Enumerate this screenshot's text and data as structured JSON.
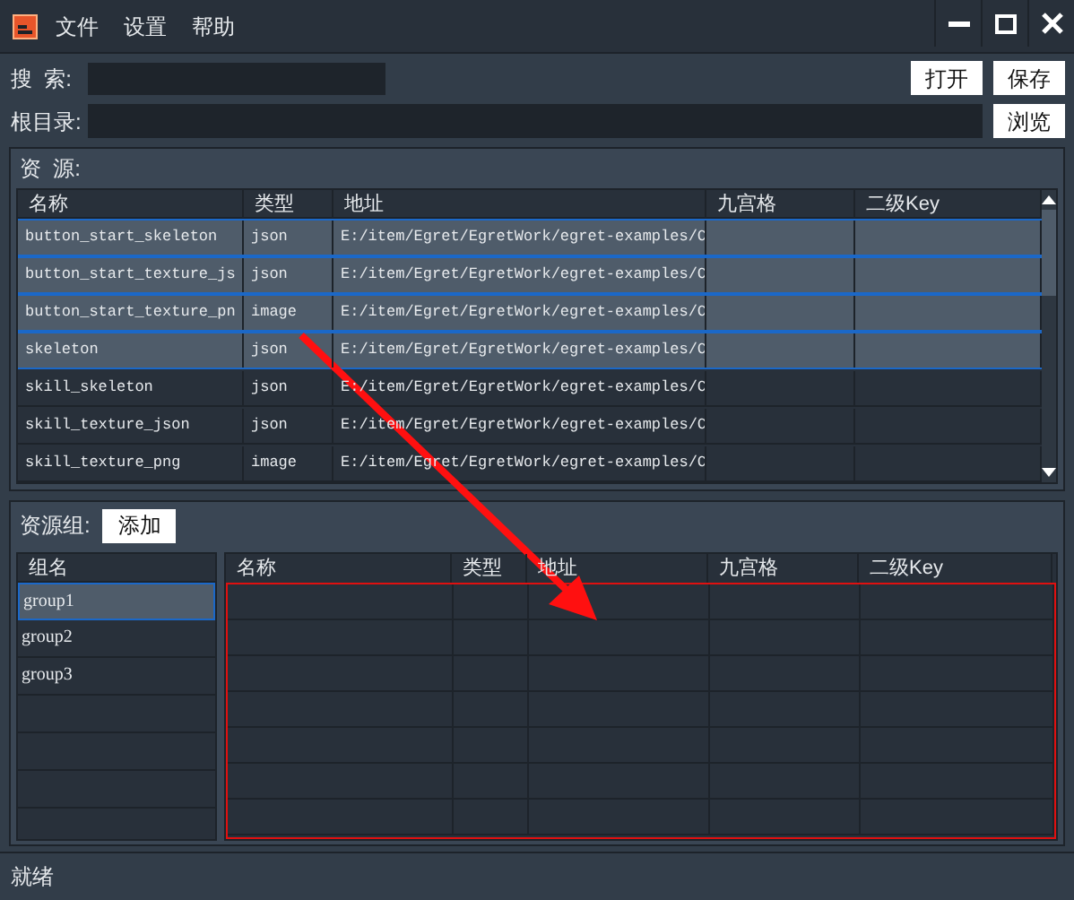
{
  "menu": [
    "文件",
    "设置",
    "帮助"
  ],
  "search": {
    "label": "搜  索:"
  },
  "root": {
    "label": "根目录:"
  },
  "buttons": [
    "打开",
    "保存"
  ],
  "browse_button": "浏览",
  "resources": {
    "title": "资  源:",
    "columns": [
      "名称",
      "类型",
      "地址",
      "九宫格",
      "二级Key"
    ],
    "rows": [
      {
        "name": "button_start_skeleton",
        "type": "json",
        "path": "E:/item/Egret/EgretWork/egret-examples/C",
        "selected": true
      },
      {
        "name": "button_start_texture_js",
        "type": "json",
        "path": "E:/item/Egret/EgretWork/egret-examples/C",
        "selected": true
      },
      {
        "name": "button_start_texture_pn",
        "type": "image",
        "path": "E:/item/Egret/EgretWork/egret-examples/C",
        "selected": true
      },
      {
        "name": "skeleton",
        "type": "json",
        "path": "E:/item/Egret/EgretWork/egret-examples/C",
        "selected": true
      },
      {
        "name": "skill_skeleton",
        "type": "json",
        "path": "E:/item/Egret/EgretWork/egret-examples/C",
        "selected": false
      },
      {
        "name": "skill_texture_json",
        "type": "json",
        "path": "E:/item/Egret/EgretWork/egret-examples/C",
        "selected": false
      },
      {
        "name": "skill_texture_png",
        "type": "image",
        "path": "E:/item/Egret/EgretWork/egret-examples/C",
        "selected": false
      }
    ]
  },
  "groups": {
    "label": "资源组:",
    "add_button": "添加",
    "column": "组名",
    "items": [
      {
        "name": "group1",
        "selected": true
      },
      {
        "name": "group2",
        "selected": false
      },
      {
        "name": "group3",
        "selected": false
      }
    ]
  },
  "group_resources": {
    "columns": [
      "名称",
      "类型",
      "地址",
      "九宫格",
      "二级Key"
    ]
  },
  "status_bar": "就绪"
}
